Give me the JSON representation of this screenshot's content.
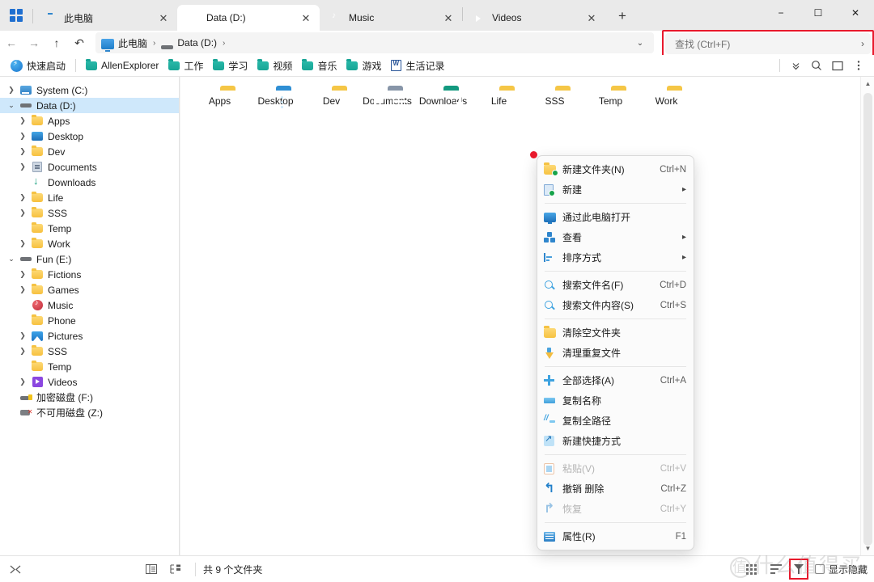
{
  "window": {
    "minimize": "−",
    "maximize": "☐",
    "close": "✕",
    "start_icon": "windows-grid-icon"
  },
  "tabs": [
    {
      "label": "此电脑",
      "icon": "pc-icon",
      "active": false
    },
    {
      "label": "Data (D:)",
      "icon": "drive-icon",
      "active": true
    },
    {
      "label": "Music",
      "icon": "music-icon",
      "active": false
    },
    {
      "label": "Videos",
      "icon": "video-icon",
      "active": false
    }
  ],
  "new_tab_label": "+",
  "nav": {
    "back": "←",
    "forward": "→",
    "up": "↑",
    "refresh": "↶",
    "dropdown": "⌄"
  },
  "breadcrumb": [
    {
      "label": "此电脑",
      "icon": "pc-icon"
    },
    {
      "label": "Data (D:)",
      "icon": "drive-icon"
    }
  ],
  "breadcrumb_separator": "›",
  "search": {
    "placeholder": "查找 (Ctrl+F)",
    "expand_arrow": "›",
    "highlight_color": "#e8192c"
  },
  "bookmarks": {
    "quick_launch": {
      "label": "快速启动",
      "icon": "lightning-icon"
    },
    "items": [
      {
        "label": "AllenExplorer",
        "icon": "folder-teal-icon"
      },
      {
        "label": "工作",
        "icon": "folder-teal-icon"
      },
      {
        "label": "学习",
        "icon": "folder-teal-icon"
      },
      {
        "label": "视频",
        "icon": "folder-teal-icon"
      },
      {
        "label": "音乐",
        "icon": "folder-teal-icon"
      },
      {
        "label": "游戏",
        "icon": "folder-teal-icon"
      },
      {
        "label": "生活记录",
        "icon": "word-doc-icon"
      }
    ],
    "toolbar": [
      {
        "name": "chevron-double-down-icon",
        "glyph": "⌄"
      },
      {
        "name": "search-icon",
        "glyph": "○"
      },
      {
        "name": "preview-pane-icon",
        "glyph": "▭"
      },
      {
        "name": "more-options-icon",
        "glyph": "⋮"
      }
    ]
  },
  "sidebar": {
    "items": [
      {
        "label": "System (C:)",
        "icon": "system-drive-icon",
        "indent": 0,
        "chevron": "closed",
        "selected": false
      },
      {
        "label": "Data (D:)",
        "icon": "drive-icon",
        "indent": 0,
        "chevron": "open",
        "selected": true
      },
      {
        "label": "Apps",
        "icon": "folder-icon",
        "indent": 1,
        "chevron": "closed",
        "selected": false
      },
      {
        "label": "Desktop",
        "icon": "desktop-icon",
        "indent": 1,
        "chevron": "closed",
        "selected": false
      },
      {
        "label": "Dev",
        "icon": "folder-icon",
        "indent": 1,
        "chevron": "closed",
        "selected": false
      },
      {
        "label": "Documents",
        "icon": "documents-icon",
        "indent": 1,
        "chevron": "closed",
        "selected": false
      },
      {
        "label": "Downloads",
        "icon": "downloads-icon",
        "indent": 1,
        "chevron": "none",
        "selected": false
      },
      {
        "label": "Life",
        "icon": "folder-icon",
        "indent": 1,
        "chevron": "closed",
        "selected": false
      },
      {
        "label": "SSS",
        "icon": "folder-icon",
        "indent": 1,
        "chevron": "closed",
        "selected": false
      },
      {
        "label": "Temp",
        "icon": "folder-icon",
        "indent": 1,
        "chevron": "none",
        "selected": false
      },
      {
        "label": "Work",
        "icon": "folder-icon",
        "indent": 1,
        "chevron": "closed",
        "selected": false
      },
      {
        "label": "Fun (E:)",
        "icon": "drive-icon",
        "indent": 0,
        "chevron": "open",
        "selected": false
      },
      {
        "label": "Fictions",
        "icon": "folder-icon",
        "indent": 1,
        "chevron": "closed",
        "selected": false
      },
      {
        "label": "Games",
        "icon": "folder-icon",
        "indent": 1,
        "chevron": "closed",
        "selected": false
      },
      {
        "label": "Music",
        "icon": "music-icon",
        "indent": 1,
        "chevron": "none",
        "selected": false
      },
      {
        "label": "Phone",
        "icon": "folder-icon",
        "indent": 1,
        "chevron": "none",
        "selected": false
      },
      {
        "label": "Pictures",
        "icon": "pictures-icon",
        "indent": 1,
        "chevron": "closed",
        "selected": false
      },
      {
        "label": "SSS",
        "icon": "folder-icon",
        "indent": 1,
        "chevron": "closed",
        "selected": false
      },
      {
        "label": "Temp",
        "icon": "folder-icon",
        "indent": 1,
        "chevron": "none",
        "selected": false
      },
      {
        "label": "Videos",
        "icon": "video-icon",
        "indent": 1,
        "chevron": "closed",
        "selected": false
      },
      {
        "label": "加密磁盘 (F:)",
        "icon": "encrypted-drive-icon",
        "indent": 0,
        "chevron": "none",
        "selected": false
      },
      {
        "label": "不可用磁盘 (Z:)",
        "icon": "unavailable-drive-icon",
        "indent": 0,
        "chevron": "none",
        "selected": false
      }
    ]
  },
  "files": [
    {
      "name": "Apps",
      "icon": "folder-icon"
    },
    {
      "name": "Desktop",
      "icon": "desktop-folder-icon"
    },
    {
      "name": "Dev",
      "icon": "folder-icon"
    },
    {
      "name": "Documents",
      "icon": "documents-folder-icon"
    },
    {
      "name": "Downloads",
      "icon": "downloads-folder-icon"
    },
    {
      "name": "Life",
      "icon": "folder-icon"
    },
    {
      "name": "SSS",
      "icon": "folder-icon"
    },
    {
      "name": "Temp",
      "icon": "folder-icon"
    },
    {
      "name": "Work",
      "icon": "folder-icon"
    }
  ],
  "context_menu": {
    "groups": [
      {
        "items": [
          {
            "label": "新建文件夹(N)",
            "accel": "Ctrl+N",
            "icon": "new-folder-icon",
            "submenu": false,
            "disabled": false
          },
          {
            "label": "新建",
            "accel": "",
            "icon": "new-file-icon",
            "submenu": true,
            "disabled": false
          }
        ]
      },
      {
        "items": [
          {
            "label": "通过此电脑打开",
            "accel": "",
            "icon": "open-with-pc-icon",
            "submenu": false,
            "disabled": false
          },
          {
            "label": "查看",
            "accel": "",
            "icon": "view-icon",
            "submenu": true,
            "disabled": false
          },
          {
            "label": "排序方式",
            "accel": "",
            "icon": "sort-icon",
            "submenu": true,
            "disabled": false
          }
        ]
      },
      {
        "items": [
          {
            "label": "搜索文件名(F)",
            "accel": "Ctrl+D",
            "icon": "search-filename-icon",
            "submenu": false,
            "disabled": false
          },
          {
            "label": "搜索文件内容(S)",
            "accel": "Ctrl+S",
            "icon": "search-content-icon",
            "submenu": false,
            "disabled": false
          }
        ]
      },
      {
        "items": [
          {
            "label": "清除空文件夹",
            "accel": "",
            "icon": "clear-empty-folder-icon",
            "submenu": false,
            "disabled": false
          },
          {
            "label": "清理重复文件",
            "accel": "",
            "icon": "clean-duplicates-icon",
            "submenu": false,
            "disabled": false
          }
        ]
      },
      {
        "items": [
          {
            "label": "全部选择(A)",
            "accel": "Ctrl+A",
            "icon": "select-all-icon",
            "submenu": false,
            "disabled": false
          },
          {
            "label": "复制名称",
            "accel": "",
            "icon": "copy-name-icon",
            "submenu": false,
            "disabled": false
          },
          {
            "label": "复制全路径",
            "accel": "",
            "icon": "copy-path-icon",
            "submenu": false,
            "disabled": false
          },
          {
            "label": "新建快捷方式",
            "accel": "",
            "icon": "new-shortcut-icon",
            "submenu": false,
            "disabled": false
          }
        ]
      },
      {
        "items": [
          {
            "label": "粘贴(V)",
            "accel": "Ctrl+V",
            "icon": "paste-icon",
            "submenu": false,
            "disabled": true
          },
          {
            "label": "撤销 删除",
            "accel": "Ctrl+Z",
            "icon": "undo-icon",
            "submenu": false,
            "disabled": false
          },
          {
            "label": "恢复",
            "accel": "Ctrl+Y",
            "icon": "redo-icon",
            "submenu": false,
            "disabled": true
          }
        ]
      },
      {
        "items": [
          {
            "label": "属性(R)",
            "accel": "F1",
            "icon": "properties-icon",
            "submenu": false,
            "disabled": false
          }
        ]
      }
    ],
    "submenu_arrow": "▸"
  },
  "status": {
    "left_icon": "shuffle-icon",
    "pane_icons": [
      {
        "name": "details-pane-icon",
        "glyph": "▤"
      },
      {
        "name": "navigation-pane-icon",
        "glyph": "▦"
      }
    ],
    "count_text": "共 9 个文件夹",
    "view_icons": [
      {
        "name": "grid-view-icon"
      },
      {
        "name": "list-view-icon"
      },
      {
        "name": "filter-icon",
        "highlighted": true
      }
    ],
    "show_hidden": {
      "label": "显示隐藏",
      "checked": false
    }
  },
  "watermark": {
    "circle": "值",
    "text": "什么值得买"
  }
}
